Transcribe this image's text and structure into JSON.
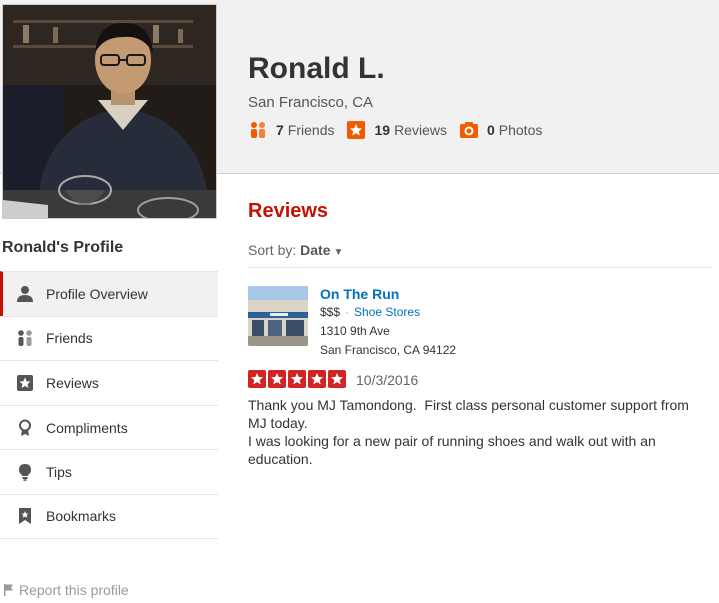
{
  "profile": {
    "name": "Ronald L.",
    "location": "San Francisco, CA",
    "stats": {
      "friends_count": "7",
      "friends_label": "Friends",
      "reviews_count": "19",
      "reviews_label": "Reviews",
      "photos_count": "0",
      "photos_label": "Photos"
    }
  },
  "sidebar": {
    "title": "Ronald's Profile",
    "items": [
      {
        "label": "Profile Overview",
        "icon": "person-icon",
        "active": true
      },
      {
        "label": "Friends",
        "icon": "friends-icon"
      },
      {
        "label": "Reviews",
        "icon": "star-icon"
      },
      {
        "label": "Compliments",
        "icon": "award-icon"
      },
      {
        "label": "Tips",
        "icon": "lightbulb-icon"
      },
      {
        "label": "Bookmarks",
        "icon": "bookmark-icon"
      }
    ],
    "report_label": "Report this profile"
  },
  "reviews": {
    "title": "Reviews",
    "sort_prefix": "Sort by:",
    "sort_value": "Date",
    "items": [
      {
        "business_name": "On The Run",
        "price": "$$$",
        "category": "Shoe Stores",
        "address_line1": "1310 9th Ave",
        "address_line2": "San Francisco, CA 94122",
        "rating": 5,
        "date": "10/3/2016",
        "text_line1": "Thank you MJ Tamondong.  First class personal customer support from MJ today.",
        "text_line2": "I was looking for a new pair of running shoes and walk out with an education."
      }
    ]
  },
  "colors": {
    "brand_red": "#c41200",
    "star_red": "#d32323",
    "link_blue": "#0073bb",
    "stat_orange": "#f15c00"
  }
}
